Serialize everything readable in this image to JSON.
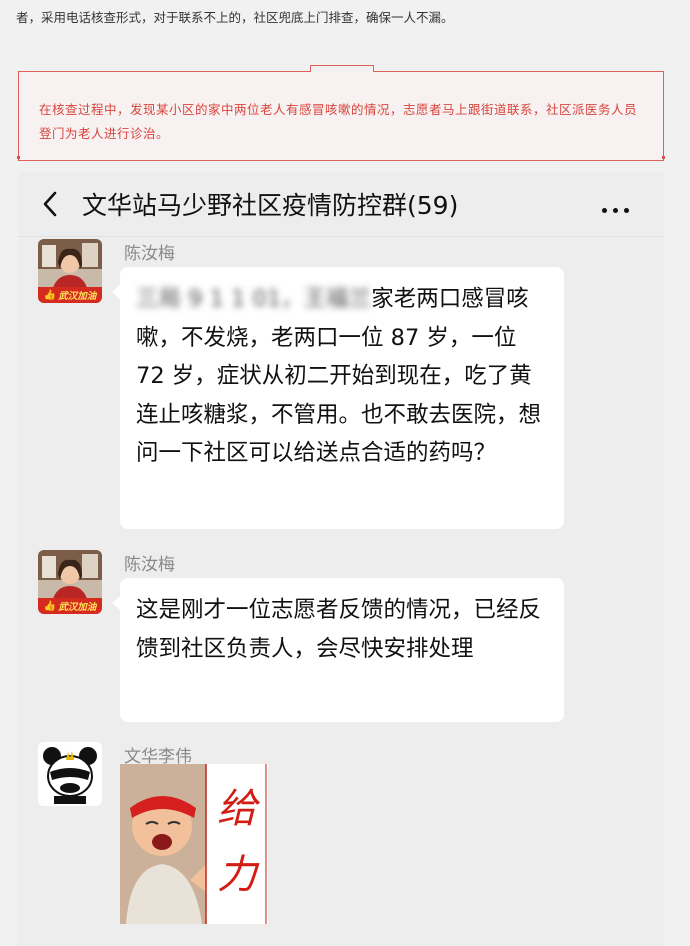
{
  "article": {
    "intro_text": "者，采用电话核查形式，对于联系不上的，社区兜底上门排查，确保一人不漏。",
    "callout_text": "在核查过程中，发现某小区的家中两位老人有感冒咳嗽的情况，志愿者马上跟街道联系，社区派医务人员登门为老人进行诊治。"
  },
  "chat": {
    "title": "文华站马少野社区疫情防控群(59)",
    "back_icon": "chevron-left-icon",
    "more_icon": "ellipsis-icon",
    "messages": [
      {
        "sender": "陈汝梅",
        "avatar_badge": "武汉加油",
        "blurred_prefix": "三局 9 1 1 01，王福兰",
        "text_line1_suffix": "家老两口感冒",
        "text_rest": "咳嗽，不发烧，老两口一位 87 岁，一位 72 岁，症状从初二开始到现在，吃了黄连止咳糖浆，不管用。也不敢去医院，想问一下社区可以给送点合适的药吗？"
      },
      {
        "sender": "陈汝梅",
        "avatar_badge": "武汉加油",
        "text": "这是刚才一位志愿者反馈的情况，已经反馈到社区负责人，会尽快安排处理"
      },
      {
        "sender": "文华李伟",
        "avatar_icon": "panda-icon",
        "sticker_text": "给力"
      }
    ]
  },
  "colors": {
    "callout_red": "#d9453d",
    "chat_bg": "#ededed",
    "bubble_bg": "#ffffff"
  }
}
